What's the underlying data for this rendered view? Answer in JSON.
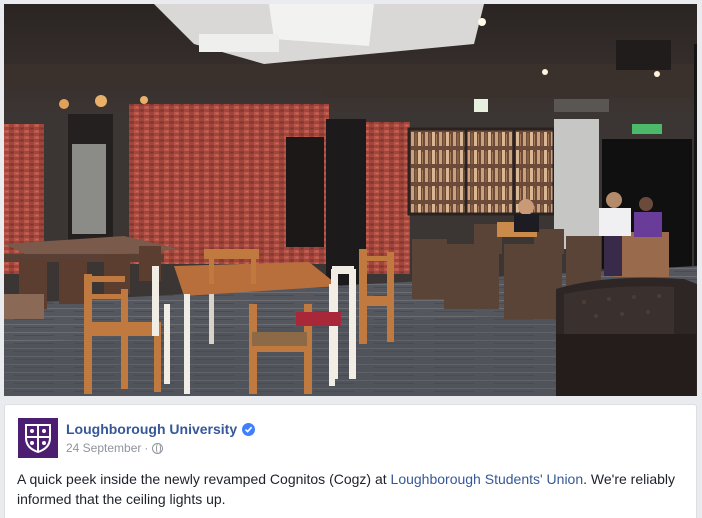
{
  "post": {
    "page_name": "Loughborough University",
    "verified_icon": "verified-badge-icon",
    "date": "24 September",
    "separator": "·",
    "privacy_icon": "globe-icon",
    "text_before": "A quick peek inside the newly revamped Cognitos (Cogz) at ",
    "mention": "Loughborough Students' Union",
    "text_after": ". We're reliably informed that the ceiling lights up."
  },
  "colors": {
    "link": "#365899",
    "avatar_bg": "#4b1e72",
    "verified": "#4080ff",
    "meta": "#90949c",
    "text": "#1d2129"
  }
}
